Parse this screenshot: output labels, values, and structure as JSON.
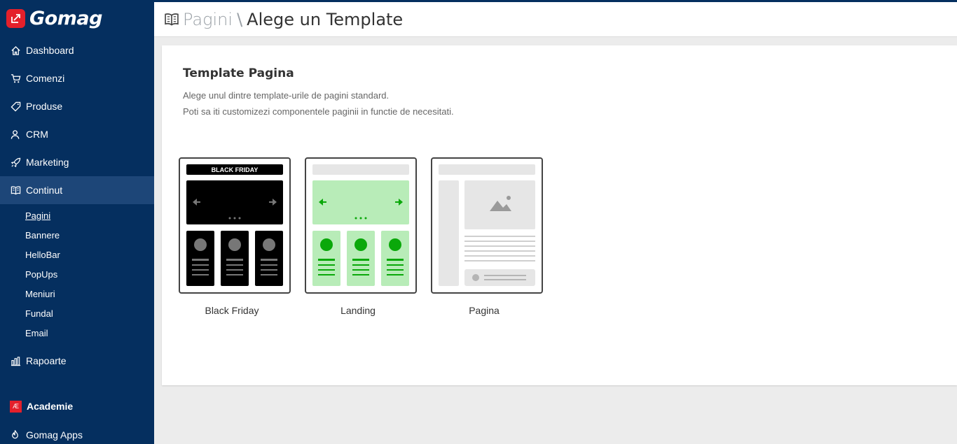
{
  "brand": {
    "name": "Gomag",
    "accent": "#e4202b",
    "sidebar_bg": "#052f5f"
  },
  "sidebar": {
    "items": [
      {
        "label": "Dashboard",
        "icon": "home-icon"
      },
      {
        "label": "Comenzi",
        "icon": "cart-icon"
      },
      {
        "label": "Produse",
        "icon": "tag-icon"
      },
      {
        "label": "CRM",
        "icon": "users-icon"
      },
      {
        "label": "Marketing",
        "icon": "rocket-icon"
      },
      {
        "label": "Continut",
        "icon": "book-icon",
        "active": true
      }
    ],
    "sub_items": [
      {
        "label": "Pagini",
        "current": true
      },
      {
        "label": "Bannere"
      },
      {
        "label": "HelloBar"
      },
      {
        "label": "PopUps"
      },
      {
        "label": "Meniuri"
      },
      {
        "label": "Fundal"
      },
      {
        "label": "Email"
      }
    ],
    "rapoarte": {
      "label": "Rapoarte",
      "icon": "bar-chart-icon"
    },
    "academie": {
      "label": "Academie",
      "badge": "Æ"
    },
    "apps": {
      "label": "Gomag Apps",
      "icon": "flame-icon"
    }
  },
  "header": {
    "parent": "Pagini",
    "separator": "\\",
    "current": "Alege un Template"
  },
  "card": {
    "title": "Template Pagina",
    "desc_line1": "Alege unul dintre template-urile de pagini standard.",
    "desc_line2": "Poti sa iti customizezi componentele paginii in functie de necesitati."
  },
  "templates": [
    {
      "label": "Black Friday",
      "banner": "BLACK FRIDAY"
    },
    {
      "label": "Landing"
    },
    {
      "label": "Pagina"
    }
  ]
}
